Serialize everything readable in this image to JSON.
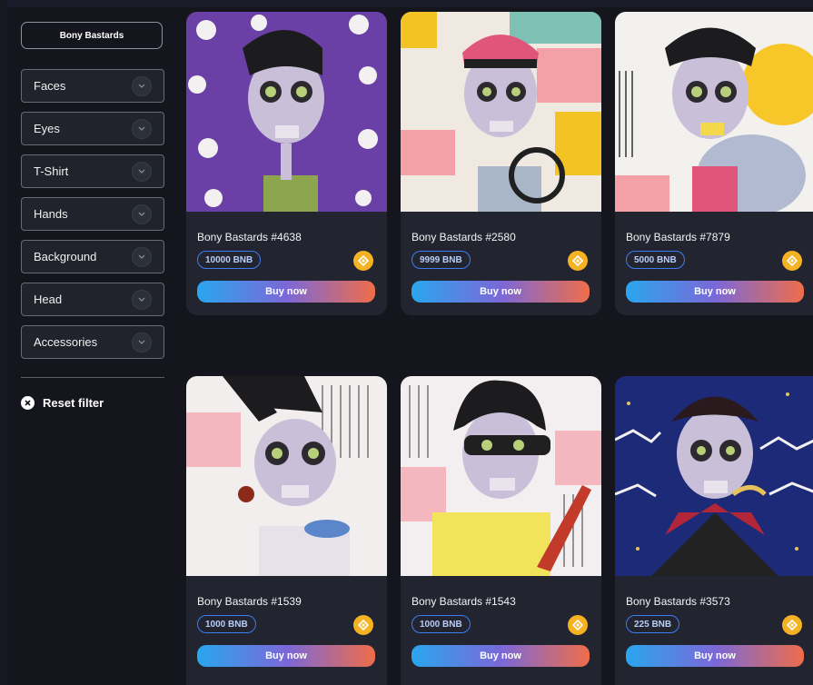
{
  "sidebar": {
    "collection_label": "Bony Bastards",
    "filters": [
      {
        "label": "Faces"
      },
      {
        "label": "Eyes"
      },
      {
        "label": "T-Shirt"
      },
      {
        "label": "Hands"
      },
      {
        "label": "Background"
      },
      {
        "label": "Head"
      },
      {
        "label": "Accessories"
      }
    ],
    "reset_label": "Reset filter"
  },
  "cards": [
    {
      "name": "Bony Bastards #4638",
      "price": "10000 BNB",
      "buy_label": "Buy now",
      "art_background": "#6a3fa6"
    },
    {
      "name": "Bony Bastards #2580",
      "price": "9999 BNB",
      "buy_label": "Buy now",
      "art_background": "#efe9e1"
    },
    {
      "name": "Bony Bastards #7879",
      "price": "5000 BNB",
      "buy_label": "Buy now",
      "art_background": "#f3f1ee"
    },
    {
      "name": "Bony Bastards #1539",
      "price": "1000 BNB",
      "buy_label": "Buy now",
      "art_background": "#f2eeee"
    },
    {
      "name": "Bony Bastards #1543",
      "price": "1000 BNB",
      "buy_label": "Buy now",
      "art_background": "#f3eff1"
    },
    {
      "name": "Bony Bastards #3573",
      "price": "225 BNB",
      "buy_label": "Buy now",
      "art_background": "#1d2a78"
    }
  ],
  "colors": {
    "page_background": "#15161d",
    "card_background": "#222530",
    "price_border": "#3c7df2",
    "coin": "#f5b324",
    "button_gradient": [
      "#2aa6ee",
      "#7a68d8",
      "#ef6d4a"
    ]
  },
  "icons": {
    "filter_toggle": "chevron-down-icon",
    "reset": "close-circle-icon",
    "currency": "bnb-coin-icon"
  }
}
